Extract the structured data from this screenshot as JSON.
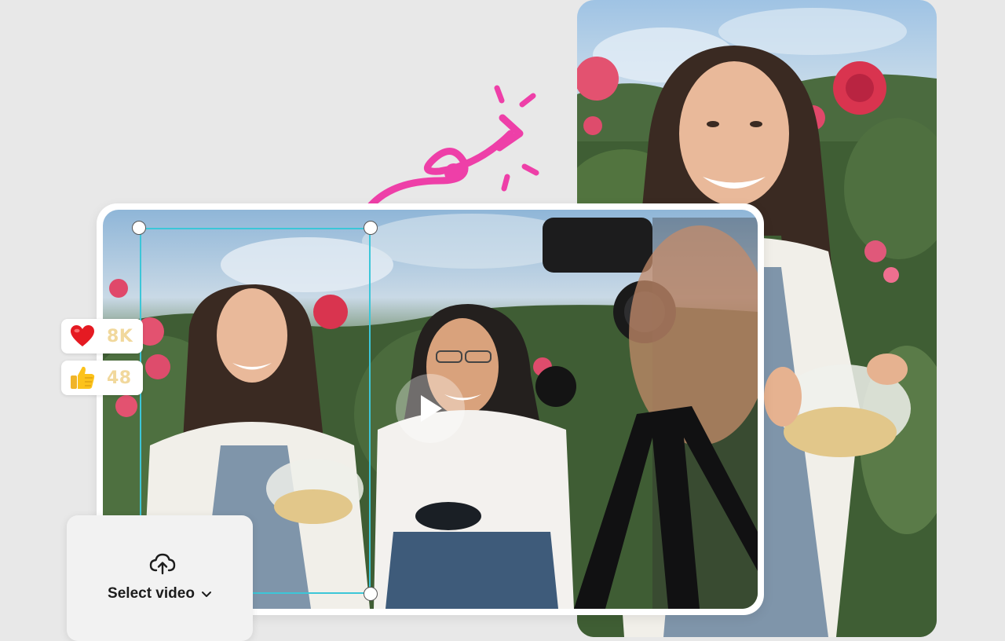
{
  "reactions": [
    {
      "icon": "heart-icon",
      "count": "8K"
    },
    {
      "icon": "thumbs-up-icon",
      "count": "48"
    }
  ],
  "select_video": {
    "label": "Select video",
    "icon": "upload-cloud-icon"
  },
  "colors": {
    "crop_border": "#3cc6d8",
    "arrow": "#ee3fa8",
    "count_text": "#f1d89c",
    "background": "#e8e8e8"
  }
}
